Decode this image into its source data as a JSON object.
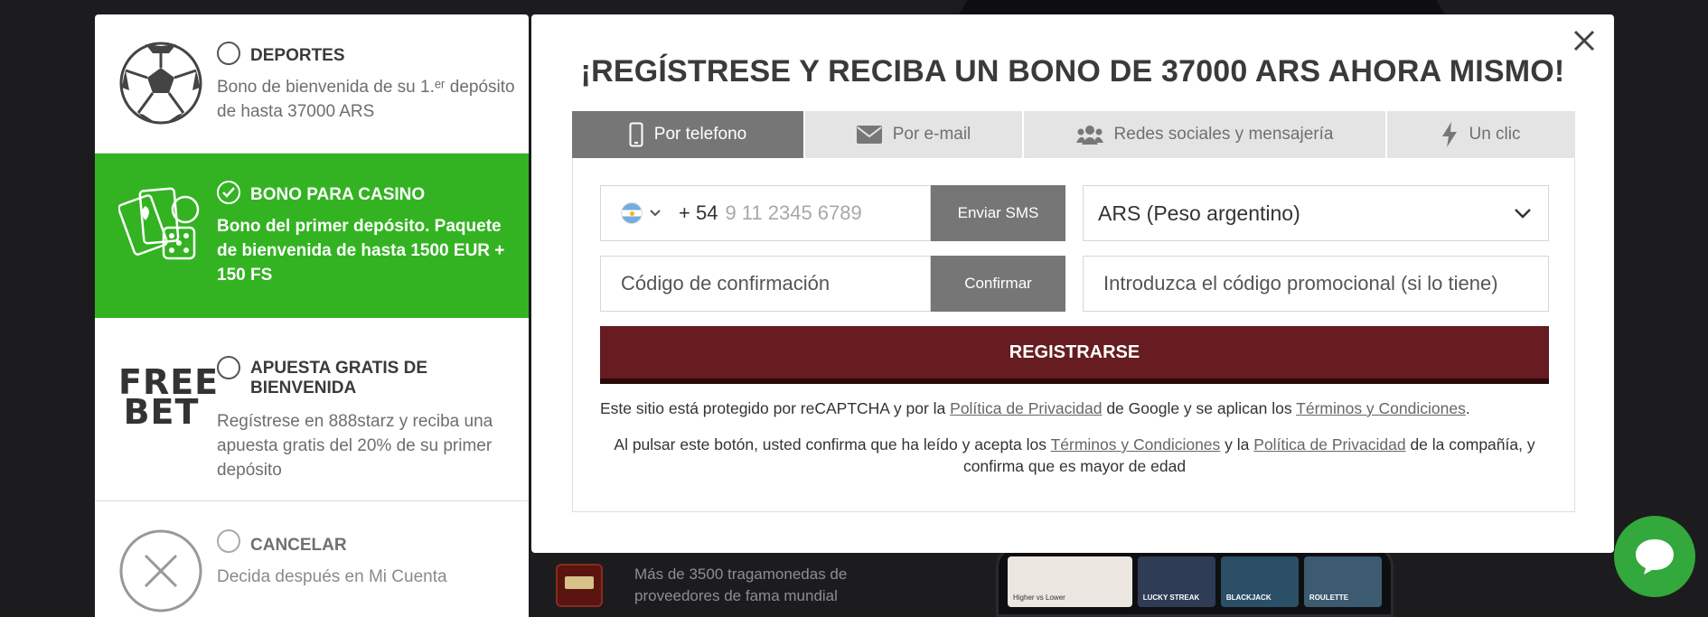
{
  "background": {
    "promo_text": "Más de 3500 tragamonedas de proveedores de fama mundial",
    "phone_tiles": [
      "Higher vs Lower",
      "LUCKY STREAK",
      "BLACKJACK",
      "ROULETTE"
    ]
  },
  "bonuses": {
    "sports": {
      "title": "DEPORTES",
      "desc": "Bono de bienvenida de su 1.ᵉʳ depósito de hasta 37000 ARS"
    },
    "casino": {
      "title": "BONO PARA CASINO",
      "desc": "Bono del primer depósito. Paquete de bienvenida de hasta 1500 EUR + 150 FS",
      "selected": true
    },
    "freebet": {
      "logo_line1": "FREE",
      "logo_line2": "BET",
      "title": "APUESTA GRATIS DE BIENVENIDA",
      "desc": "Regístrese en 888starz y reciba una apuesta gratis del 20% de su primer depósito"
    },
    "cancel": {
      "title": "CANCELAR",
      "desc": "Decida después en Mi Cuenta"
    }
  },
  "modal": {
    "title": "¡REGÍSTRESE Y RECIBA UN BONO DE 37000 ARS AHORA MISMO!",
    "tabs": [
      {
        "label": "Por telefono",
        "icon": "smartphone-icon",
        "active": true
      },
      {
        "label": "Por e-mail",
        "icon": "envelope-icon",
        "active": false
      },
      {
        "label": "Redes sociales y mensajería",
        "icon": "users-icon",
        "active": false
      },
      {
        "label": "Un clic",
        "icon": "lightning-icon",
        "active": false
      }
    ],
    "form": {
      "phone_code": "+ 54",
      "phone_placeholder": "9 11 2345 6789",
      "sms_button": "Enviar SMS",
      "currency": "ARS (Peso argentino)",
      "code_placeholder": "Código de confirmación",
      "confirm_button": "Confirmar",
      "promo_placeholder": "Introduzca el código promocional (si lo tiene)",
      "register_button": "REGISTRARSE"
    },
    "legal": {
      "recaptcha_prefix": "Este sitio está protegido por reCAPTCHA y por la",
      "privacy_link": "Política de Privacidad",
      "recaptcha_middle": "de Google y se aplican los",
      "terms_link": "Términos y Condiciones",
      "recaptcha_suffix": ".",
      "consent_prefix": "Al pulsar este botón, usted confirma que ha leído y acepta los",
      "consent_terms_link": "Términos y Condiciones",
      "consent_middle": "y la",
      "consent_privacy_link": "Política de Privacidad",
      "consent_suffix": "de la compañía, y confirma que es mayor de edad"
    }
  },
  "colors": {
    "casino_green": "#33b322",
    "register_red": "#661c20",
    "tab_active": "#767676",
    "chat_green": "#33a83c"
  }
}
